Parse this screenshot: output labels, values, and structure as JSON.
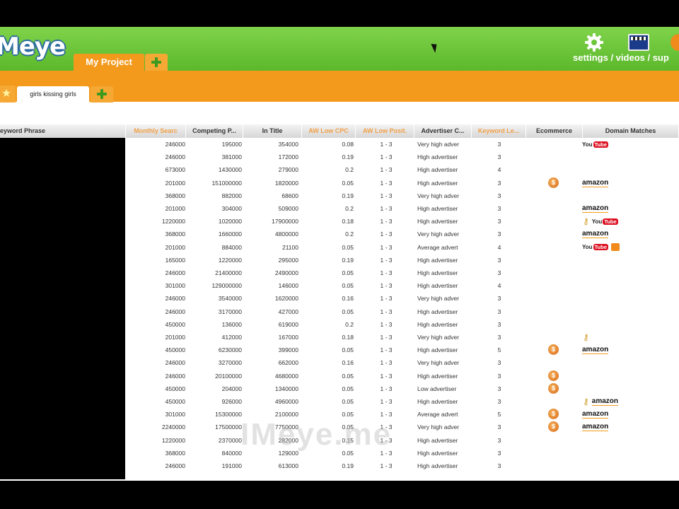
{
  "app": {
    "logo": "Meye",
    "project_tab": "My Project",
    "header_links": "settings / videos / sup",
    "keyword_tab": "girls kissing girls",
    "watermark": "IMeye.me"
  },
  "colors": {
    "header_green": "#6cc63a",
    "accent_orange": "#f39a1d",
    "highlight_header_text": "#f0a048"
  },
  "icons": {
    "settings": "gear-icon",
    "videos": "video-icon",
    "support": "support-icon",
    "add": "plus-icon",
    "favorites": "star-icon"
  },
  "table": {
    "columns": [
      {
        "label": "eyword Phrase",
        "highlight": false
      },
      {
        "label": "Monthly Searc",
        "highlight": true
      },
      {
        "label": "Competing P...",
        "highlight": false
      },
      {
        "label": "In Title",
        "highlight": false
      },
      {
        "label": "AW Low CPC",
        "highlight": true
      },
      {
        "label": "AW Low Posit.",
        "highlight": true
      },
      {
        "label": "Advertiser C...",
        "highlight": false
      },
      {
        "label": "Keyword Le...",
        "highlight": true
      },
      {
        "label": "Ecommerce",
        "highlight": false
      },
      {
        "label": "Domain Matches",
        "highlight": false
      }
    ],
    "rows": [
      {
        "searches": "246000",
        "competing": "195000",
        "in_title": "354000",
        "cpc": "0.08",
        "pos": "1 - 3",
        "adv": "Very high adver",
        "kl": "3",
        "ecom": false,
        "domains": [
          "youtube"
        ]
      },
      {
        "searches": "246000",
        "competing": "381000",
        "in_title": "172000",
        "cpc": "0.19",
        "pos": "1 - 3",
        "adv": "High advertiser",
        "kl": "3",
        "ecom": false,
        "domains": []
      },
      {
        "searches": "673000",
        "competing": "1430000",
        "in_title": "279000",
        "cpc": "0.2",
        "pos": "1 - 3",
        "adv": "High advertiser",
        "kl": "4",
        "ecom": false,
        "domains": []
      },
      {
        "searches": "201000",
        "competing": "151000000",
        "in_title": "1820000",
        "cpc": "0.05",
        "pos": "1 - 3",
        "adv": "High advertiser",
        "kl": "3",
        "ecom": true,
        "domains": [
          "amazon"
        ]
      },
      {
        "searches": "368000",
        "competing": "882000",
        "in_title": "68600",
        "cpc": "0.19",
        "pos": "1 - 3",
        "adv": "Very high adver",
        "kl": "3",
        "ecom": false,
        "domains": []
      },
      {
        "searches": "201000",
        "competing": "304000",
        "in_title": "509000",
        "cpc": "0.2",
        "pos": "1 - 3",
        "adv": "High advertiser",
        "kl": "3",
        "ecom": false,
        "domains": [
          "amazon"
        ]
      },
      {
        "searches": "1220000",
        "competing": "1020000",
        "in_title": "17900000",
        "cpc": "0.18",
        "pos": "1 - 3",
        "adv": "High advertiser",
        "kl": "3",
        "ecom": false,
        "domains": [
          "key",
          "youtube"
        ]
      },
      {
        "searches": "368000",
        "competing": "1660000",
        "in_title": "4800000",
        "cpc": "0.2",
        "pos": "1 - 3",
        "adv": "Very high adver",
        "kl": "3",
        "ecom": false,
        "domains": [
          "amazon"
        ]
      },
      {
        "searches": "201000",
        "competing": "884000",
        "in_title": "21100",
        "cpc": "0.05",
        "pos": "1 - 3",
        "adv": "Average advert",
        "kl": "4",
        "ecom": false,
        "domains": [
          "youtube",
          "blog"
        ]
      },
      {
        "searches": "165000",
        "competing": "1220000",
        "in_title": "295000",
        "cpc": "0.19",
        "pos": "1 - 3",
        "adv": "High advertiser",
        "kl": "3",
        "ecom": false,
        "domains": []
      },
      {
        "searches": "246000",
        "competing": "21400000",
        "in_title": "2490000",
        "cpc": "0.05",
        "pos": "1 - 3",
        "adv": "High advertiser",
        "kl": "3",
        "ecom": false,
        "domains": []
      },
      {
        "searches": "301000",
        "competing": "129000000",
        "in_title": "146000",
        "cpc": "0.05",
        "pos": "1 - 3",
        "adv": "High advertiser",
        "kl": "4",
        "ecom": false,
        "domains": []
      },
      {
        "searches": "246000",
        "competing": "3540000",
        "in_title": "1620000",
        "cpc": "0.16",
        "pos": "1 - 3",
        "adv": "Very high adver",
        "kl": "3",
        "ecom": false,
        "domains": []
      },
      {
        "searches": "246000",
        "competing": "3170000",
        "in_title": "427000",
        "cpc": "0.05",
        "pos": "1 - 3",
        "adv": "High advertiser",
        "kl": "3",
        "ecom": false,
        "domains": []
      },
      {
        "searches": "450000",
        "competing": "136000",
        "in_title": "619000",
        "cpc": "0.2",
        "pos": "1 - 3",
        "adv": "High advertiser",
        "kl": "3",
        "ecom": false,
        "domains": []
      },
      {
        "searches": "201000",
        "competing": "412000",
        "in_title": "167000",
        "cpc": "0.18",
        "pos": "1 - 3",
        "adv": "Very high adver",
        "kl": "3",
        "ecom": false,
        "domains": [
          "key"
        ]
      },
      {
        "searches": "450000",
        "competing": "6230000",
        "in_title": "399000",
        "cpc": "0.05",
        "pos": "1 - 3",
        "adv": "High advertiser",
        "kl": "5",
        "ecom": true,
        "domains": [
          "amazon"
        ]
      },
      {
        "searches": "246000",
        "competing": "3270000",
        "in_title": "662000",
        "cpc": "0.16",
        "pos": "1 - 3",
        "adv": "Very high adver",
        "kl": "3",
        "ecom": false,
        "domains": []
      },
      {
        "searches": "246000",
        "competing": "20100000",
        "in_title": "4680000",
        "cpc": "0.05",
        "pos": "1 - 3",
        "adv": "High advertiser",
        "kl": "3",
        "ecom": true,
        "domains": []
      },
      {
        "searches": "450000",
        "competing": "204000",
        "in_title": "1340000",
        "cpc": "0.05",
        "pos": "1 - 3",
        "adv": "Low advertiser",
        "kl": "3",
        "ecom": true,
        "domains": []
      },
      {
        "searches": "450000",
        "competing": "926000",
        "in_title": "4960000",
        "cpc": "0.05",
        "pos": "1 - 3",
        "adv": "High advertiser",
        "kl": "3",
        "ecom": false,
        "domains": [
          "key",
          "amazon"
        ]
      },
      {
        "searches": "301000",
        "competing": "15300000",
        "in_title": "2100000",
        "cpc": "0.05",
        "pos": "1 - 3",
        "adv": "Average advert",
        "kl": "5",
        "ecom": true,
        "domains": [
          "amazon"
        ]
      },
      {
        "searches": "2240000",
        "competing": "17500000",
        "in_title": "7750000",
        "cpc": "0.05",
        "pos": "1 - 3",
        "adv": "Very high adver",
        "kl": "3",
        "ecom": true,
        "domains": [
          "amazon"
        ]
      },
      {
        "searches": "1220000",
        "competing": "2370000",
        "in_title": "282000",
        "cpc": "0.15",
        "pos": "1 - 3",
        "adv": "High advertiser",
        "kl": "3",
        "ecom": false,
        "domains": []
      },
      {
        "searches": "368000",
        "competing": "840000",
        "in_title": "129000",
        "cpc": "0.05",
        "pos": "1 - 3",
        "adv": "High advertiser",
        "kl": "3",
        "ecom": false,
        "domains": []
      },
      {
        "searches": "246000",
        "competing": "191000",
        "in_title": "613000",
        "cpc": "0.19",
        "pos": "1 - 3",
        "adv": "High advertiser",
        "kl": "3",
        "ecom": false,
        "domains": []
      }
    ]
  }
}
